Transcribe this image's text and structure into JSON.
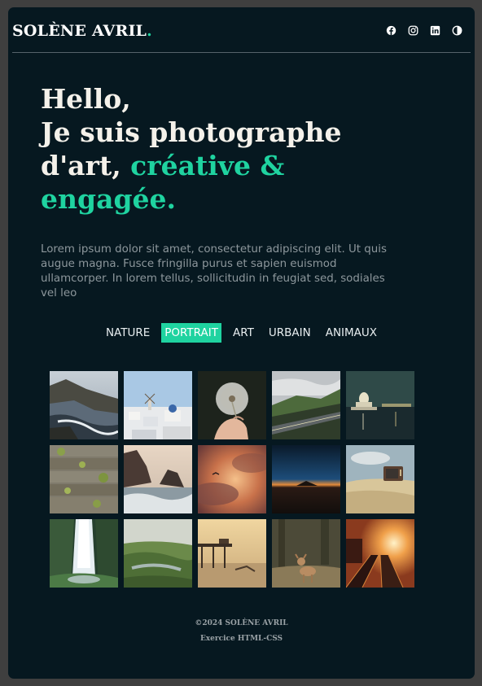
{
  "header": {
    "logo_text": "SOLÈNE AVRIL",
    "logo_dot": ".",
    "social_icons": [
      "facebook-icon",
      "instagram-icon",
      "linkedin-icon",
      "theme-toggle-icon"
    ]
  },
  "hero": {
    "line1": "Hello,",
    "line2": "Je suis photographe",
    "line3_plain": "d'art, ",
    "line3_accent": "créative &",
    "line4_accent": "engagée."
  },
  "intro": {
    "text": "Lorem ipsum dolor sit amet, consectetur adipiscing elit. Ut quis augue magna. Fusce fringilla purus et sapien euismod ullamcorper. In lorem tellus, sollicitudin in feugiat sed, sodiales vel leo"
  },
  "filters": {
    "items": [
      "NATURE",
      "PORTRAIT",
      "ART",
      "URBAIN",
      "ANIMAUX"
    ],
    "selected": "PORTRAIT"
  },
  "gallery": {
    "photos": [
      "coastal-cliffs-photo",
      "santorini-windmills-photo",
      "dandelion-hand-photo",
      "mountain-road-photo",
      "capitol-night-photo",
      "mossy-planks-photo",
      "beach-rocks-photo",
      "sunset-clouds-bird-photo",
      "night-horizon-photo",
      "old-tv-beach-photo",
      "waterfall-photo",
      "river-valley-photo",
      "pier-sunset-photo",
      "fawn-forest-photo",
      "train-tracks-sunset-photo"
    ]
  },
  "footer": {
    "copyright": "©2024 SOLÈNE AVRIL",
    "subtitle": "Exercice HTML-CSS"
  },
  "colors": {
    "background": "#061820",
    "accent": "#1fd3a0",
    "text": "#f4f1ea"
  }
}
